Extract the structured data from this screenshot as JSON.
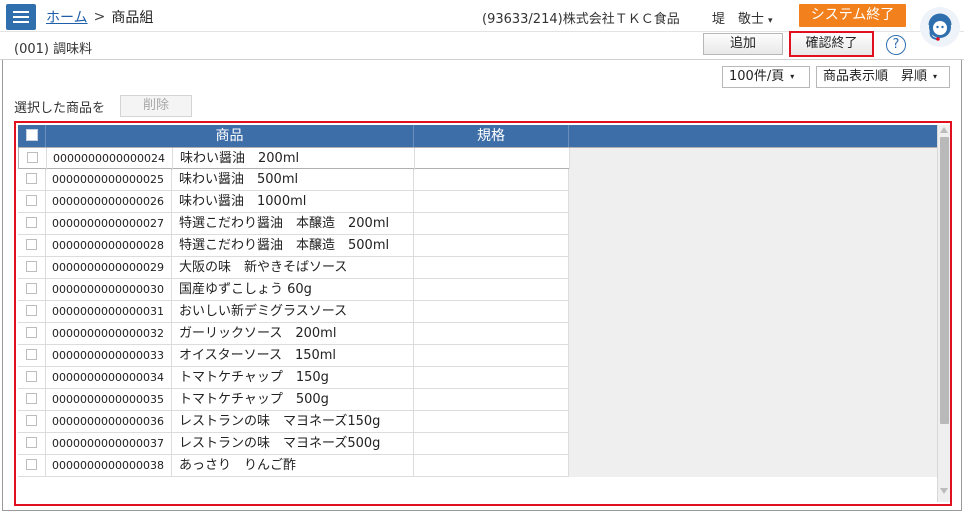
{
  "header": {
    "menu_icon": "hamburger-menu-icon",
    "breadcrumb": {
      "home": "ホーム",
      "separator": ">",
      "current": "商品組"
    },
    "company": "(93633/214)株式会社ＴＫＣ食品",
    "user": "堤　敬士",
    "user_caret": "▾",
    "system_exit": "システム終了",
    "support_icon": "support-operator-icon"
  },
  "subheader": {
    "category": "(001) 調味料",
    "add_label": "追加",
    "confirm_label": "確認終了",
    "help_label": "?"
  },
  "controls": {
    "page_size": "100件/頁",
    "sort": "商品表示順　昇順",
    "caret": "▾",
    "selected_label": "選択した商品を",
    "delete_label": "削除"
  },
  "grid": {
    "columns": {
      "product": "商品",
      "spec": "規格"
    },
    "rows": [
      {
        "code": "0000000000000024",
        "name": "味わい醤油　200ml",
        "spec": ""
      },
      {
        "code": "0000000000000025",
        "name": "味わい醤油　500ml",
        "spec": ""
      },
      {
        "code": "0000000000000026",
        "name": "味わい醤油　1000ml",
        "spec": ""
      },
      {
        "code": "0000000000000027",
        "name": "特選こだわり醤油　本醸造　200ml",
        "spec": ""
      },
      {
        "code": "0000000000000028",
        "name": "特選こだわり醤油　本醸造　500ml",
        "spec": ""
      },
      {
        "code": "0000000000000029",
        "name": "大阪の味　新やきそばソース",
        "spec": ""
      },
      {
        "code": "0000000000000030",
        "name": "国産ゆずこしょう 60g",
        "spec": ""
      },
      {
        "code": "0000000000000031",
        "name": "おいしい新デミグラスソース",
        "spec": ""
      },
      {
        "code": "0000000000000032",
        "name": "ガーリックソース　200ml",
        "spec": ""
      },
      {
        "code": "0000000000000033",
        "name": "オイスターソース　150ml",
        "spec": ""
      },
      {
        "code": "0000000000000034",
        "name": "トマトケチャップ　150g",
        "spec": ""
      },
      {
        "code": "0000000000000035",
        "name": "トマトケチャップ　500g",
        "spec": ""
      },
      {
        "code": "0000000000000036",
        "name": "レストランの味　マヨネーズ150g",
        "spec": ""
      },
      {
        "code": "0000000000000037",
        "name": "レストランの味　マヨネーズ500g",
        "spec": ""
      },
      {
        "code": "0000000000000038",
        "name": "あっさり　りんご酢",
        "spec": ""
      }
    ]
  },
  "colors": {
    "accent_blue": "#2f6fad",
    "header_blue": "#3d6ea8",
    "exit_orange": "#f2811d",
    "highlight_red": "#e0101e"
  }
}
